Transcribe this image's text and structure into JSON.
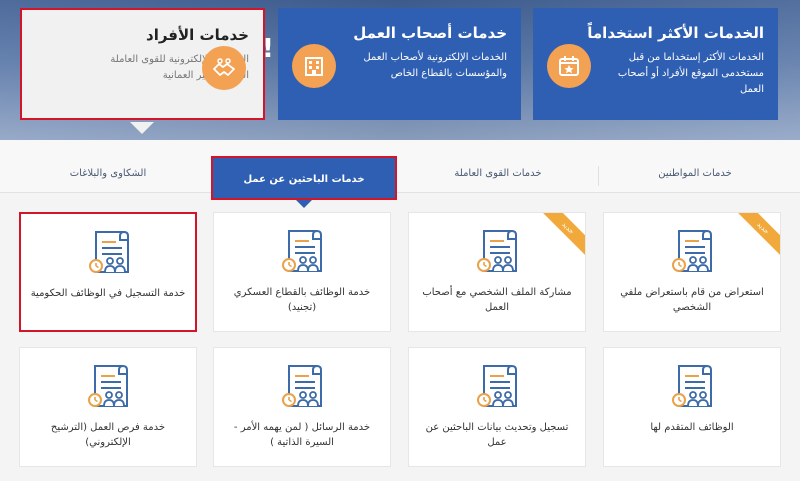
{
  "top_cards": [
    {
      "title": "الخدمات الأكثر استخداماً",
      "desc": "الخدمات الأكثر إستخداما من قبل مستخدمى الموقع الأفراد أو أصحاب العمل",
      "icon": "star-calendar-icon"
    },
    {
      "title": "خدمات أصحاب العمل",
      "desc": "الخدمات الإلكترونية لأصحاب العمل والمؤسسات بالقطاع الخاص",
      "icon": "building-icon"
    },
    {
      "title": "خدمات الأفراد",
      "desc": "الخدمات الإلكترونية للقوى العاملة العمانية وغير العمانية",
      "icon": "handshake-icon"
    }
  ],
  "tabs": [
    {
      "label": "خدمات المواطنين"
    },
    {
      "label": "خدمات القوى العاملة"
    },
    {
      "label": "خدمات الباحثين عن عمل"
    },
    {
      "label": "الشكاوى والبلاغات"
    }
  ],
  "active_tab": "خدمات الباحثين عن عمل",
  "badge_text": "جديد",
  "services": [
    {
      "label": "استعراض من قام باستعراض ملفي الشخصي",
      "new": true
    },
    {
      "label": "مشاركة الملف الشخصي مع أصحاب العمل",
      "new": true
    },
    {
      "label": "خدمة الوظائف بالقطاع العسكري (تجنيد)",
      "new": false
    },
    {
      "label": "خدمة التسجيل في الوظائف الحكومية",
      "new": false
    },
    {
      "label": "الوظائف المتقدم لها",
      "new": false
    },
    {
      "label": "تسجيل وتحديث بيانات الباحثين عن عمل",
      "new": false
    },
    {
      "label": "خدمة الرسائل ( لمن يهمه الأمر - السيرة الذاتية )",
      "new": false
    },
    {
      "label": "خدمة فرص العمل (الترشيح الإلكتروني)",
      "new": false
    }
  ],
  "colors": {
    "primary": "#2f5fb3",
    "accent": "#f3a153",
    "highlight": "#d3152a",
    "icon_blue": "#3d6aa8",
    "icon_orange": "#e9a24a"
  }
}
